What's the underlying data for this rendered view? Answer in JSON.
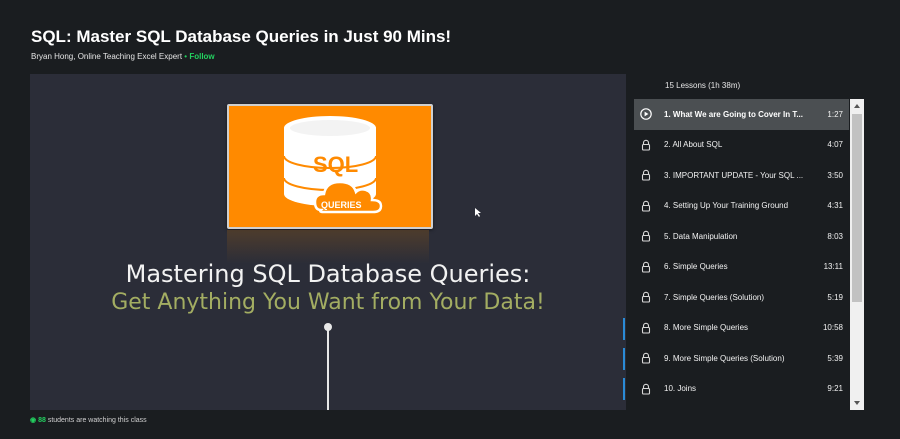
{
  "course": {
    "title": "SQL: Master SQL Database Queries in Just 90 Mins!",
    "author": "Bryan Hong, Online Teaching Excel Expert",
    "separator": "•",
    "follow_label": "Follow"
  },
  "video": {
    "card_text_top": "SQL",
    "card_text_bottom": "QUERIES",
    "slide_title": "Mastering SQL Database Queries:",
    "slide_subtitle": "Get Anything You Want from Your Data!"
  },
  "watching": {
    "count": "88",
    "text": "students are watching this class"
  },
  "lessons": {
    "summary": "15 Lessons (1h 38m)",
    "items": [
      {
        "title": "1. What We are Going to Cover In T...",
        "duration": "1:27",
        "icon": "play-icon"
      },
      {
        "title": "2. All About SQL",
        "duration": "4:07",
        "icon": "lock-icon"
      },
      {
        "title": "3. IMPORTANT UPDATE - Your SQL ...",
        "duration": "3:50",
        "icon": "lock-icon"
      },
      {
        "title": "4. Setting Up Your Training Ground",
        "duration": "4:31",
        "icon": "lock-icon"
      },
      {
        "title": "5. Data Manipulation",
        "duration": "8:03",
        "icon": "lock-icon"
      },
      {
        "title": "6. Simple Queries",
        "duration": "13:11",
        "icon": "lock-icon"
      },
      {
        "title": "7. Simple Queries (Solution)",
        "duration": "5:19",
        "icon": "lock-icon"
      },
      {
        "title": "8. More Simple Queries",
        "duration": "10:58",
        "icon": "lock-icon"
      },
      {
        "title": "9. More Simple Queries (Solution)",
        "duration": "5:39",
        "icon": "lock-icon"
      },
      {
        "title": "10. Joins",
        "duration": "9:21",
        "icon": "lock-icon"
      }
    ]
  },
  "colors": {
    "background": "#1a1d20",
    "accent_green": "#23d160",
    "card_orange": "#ff8a00",
    "subtitle_olive": "#a3ad62",
    "video_bg": "#2b2d38"
  }
}
